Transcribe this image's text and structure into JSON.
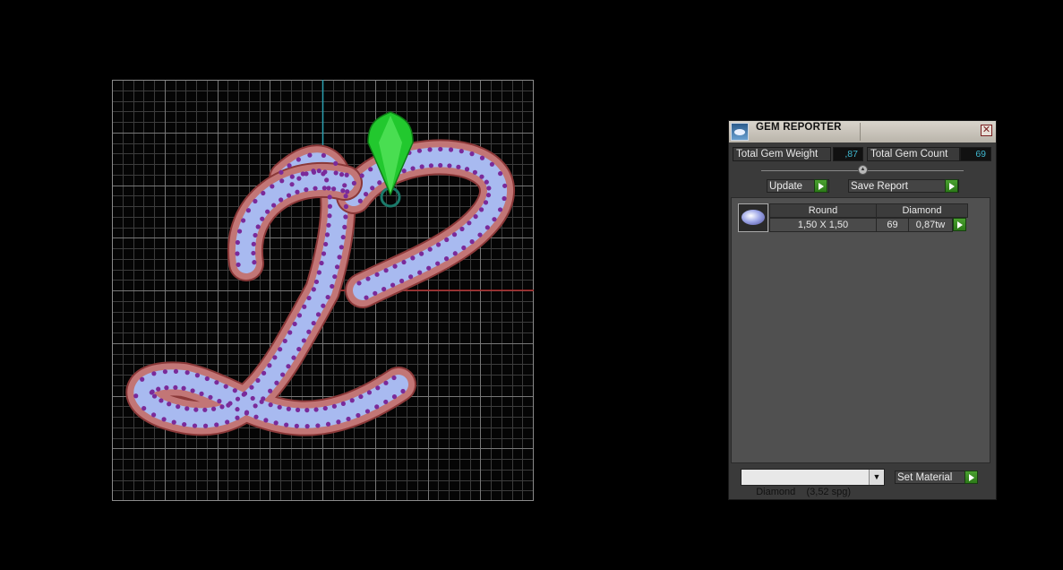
{
  "panel": {
    "title": "GEM REPORTER",
    "close_glyph": "✕",
    "total_gem_weight_label": "Total Gem Weight",
    "total_gem_weight_value": ",87",
    "total_gem_count_label": "Total Gem Count",
    "total_gem_count_value": "69",
    "update_label": "Update",
    "save_report_label": "Save Report",
    "table": {
      "headers": [
        "Round",
        "Diamond"
      ],
      "row": {
        "size": "1,50 X 1,50",
        "count": "69",
        "weight": "0,87tw",
        "icon": "round-gem-icon"
      }
    },
    "material_select_value": "Diamond    (3,52 spg)",
    "dropdown_glyph": "▼",
    "set_material_label": "Set Material"
  },
  "viewport": {
    "grid_color": "#5a5a5a",
    "axis_y_color": "#2aa0b0",
    "axis_x_color": "#b02a2a",
    "band_color": "#c07070",
    "stones_color": "#a6b8f0",
    "prong_color": "#7a2a9a",
    "gizmo_color": "#22d030"
  }
}
